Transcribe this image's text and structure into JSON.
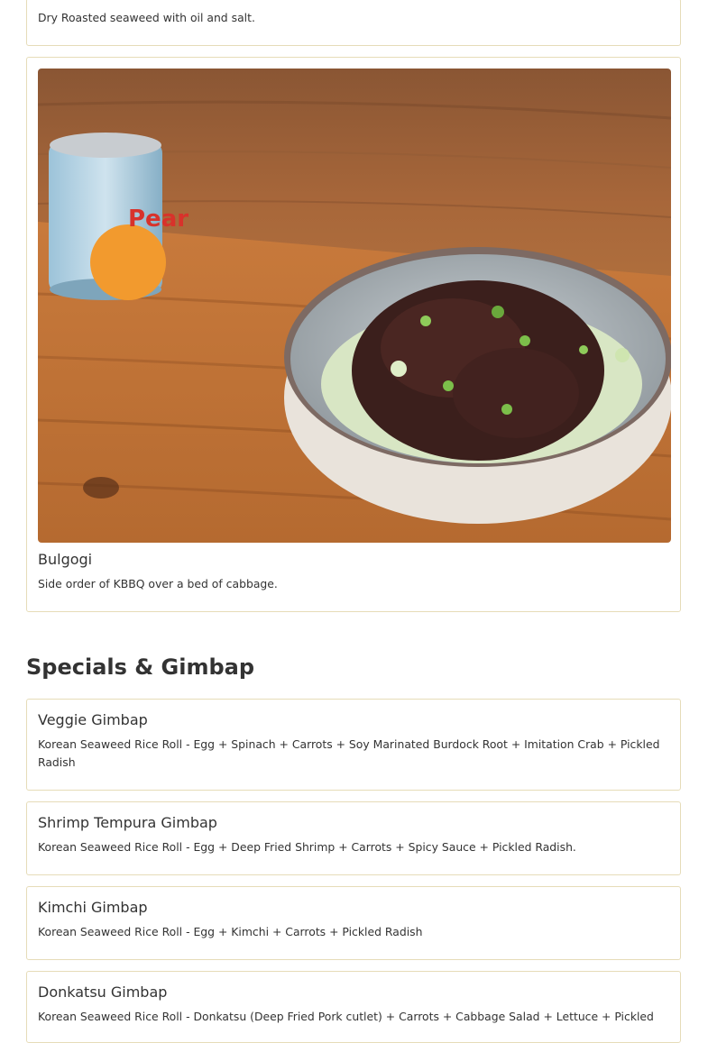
{
  "top_card": {
    "description": "Dry Roasted seaweed with oil and salt."
  },
  "bulgogi_card": {
    "title": "Bulgogi",
    "description": "Side order of KBBQ over a bed of cabbage.",
    "photo_icon": "food-photo-bulgogi"
  },
  "section": {
    "title": "Specials & Gimbap"
  },
  "items": [
    {
      "title": "Veggie Gimbap",
      "description": "Korean Seaweed Rice Roll - Egg + Spinach + Carrots + Soy Marinated Burdock Root + Imitation Crab + Pickled Radish"
    },
    {
      "title": "Shrimp Tempura Gimbap",
      "description": "Korean Seaweed Rice Roll - Egg + Deep Fried Shrimp + Carrots + Spicy Sauce + Pickled Radish."
    },
    {
      "title": "Kimchi Gimbap",
      "description": "Korean Seaweed Rice Roll - Egg + Kimchi + Carrots + Pickled Radish"
    },
    {
      "title": "Donkatsu Gimbap",
      "description": "Korean Seaweed Rice Roll - Donkatsu (Deep Fried Pork cutlet) + Carrots + Cabbage Salad + Lettuce + Pickled"
    }
  ],
  "colors": {
    "card_border": "#e6dcb8",
    "text": "#333333"
  }
}
